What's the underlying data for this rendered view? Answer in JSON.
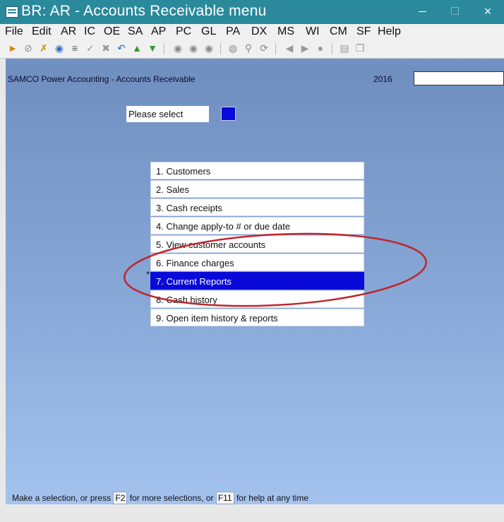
{
  "window": {
    "title": "BR: AR - Accounts Receivable menu",
    "minimize_icon": "minimize-icon",
    "maximize_icon": "maximize-icon",
    "close_glyph": "×"
  },
  "menubar": [
    "File",
    "Edit",
    "AR",
    "IC",
    "OE",
    "SA",
    "AP",
    "PC",
    "GL",
    "PA",
    "DX",
    "MS",
    "WI",
    "CM",
    "SF",
    "Help"
  ],
  "toolbar_icons": [
    "exit-icon",
    "cancel-icon",
    "tools-icon",
    "globe-icon",
    "list-icon",
    "check-icon",
    "delete-icon",
    "undo-icon",
    "up-arrow-icon",
    "down-arrow-icon",
    "record-first-icon",
    "record-mid-icon",
    "record-last-icon",
    "binoculars-icon",
    "zoom-icon",
    "refresh-icon",
    "prev-icon",
    "next-icon",
    "record-icon",
    "save-icon",
    "copy-icon"
  ],
  "app": {
    "title": "SAMCO Power Accounting - Accounts Receivable",
    "year": "2016",
    "year_field_value": ""
  },
  "prompt": {
    "label": "Please select",
    "value": ""
  },
  "menu": {
    "items": [
      "1. Customers",
      "2. Sales",
      "3. Cash receipts",
      "4. Change apply-to # or due date",
      "5. View customer accounts",
      "6. Finance charges",
      "7. Current Reports",
      "8. Cash history",
      "9. Open item history & reports"
    ],
    "selected_index": 6,
    "marker": "*"
  },
  "footer": {
    "part1": "Make a selection, or press ",
    "key1": "F2",
    "part2": " for more selections, or ",
    "key2": "F11",
    "part3": " for help at any time"
  },
  "colors": {
    "titlebar": "#2a8a9c",
    "selection": "#0a0ad8",
    "annotation": "#c0262a"
  }
}
